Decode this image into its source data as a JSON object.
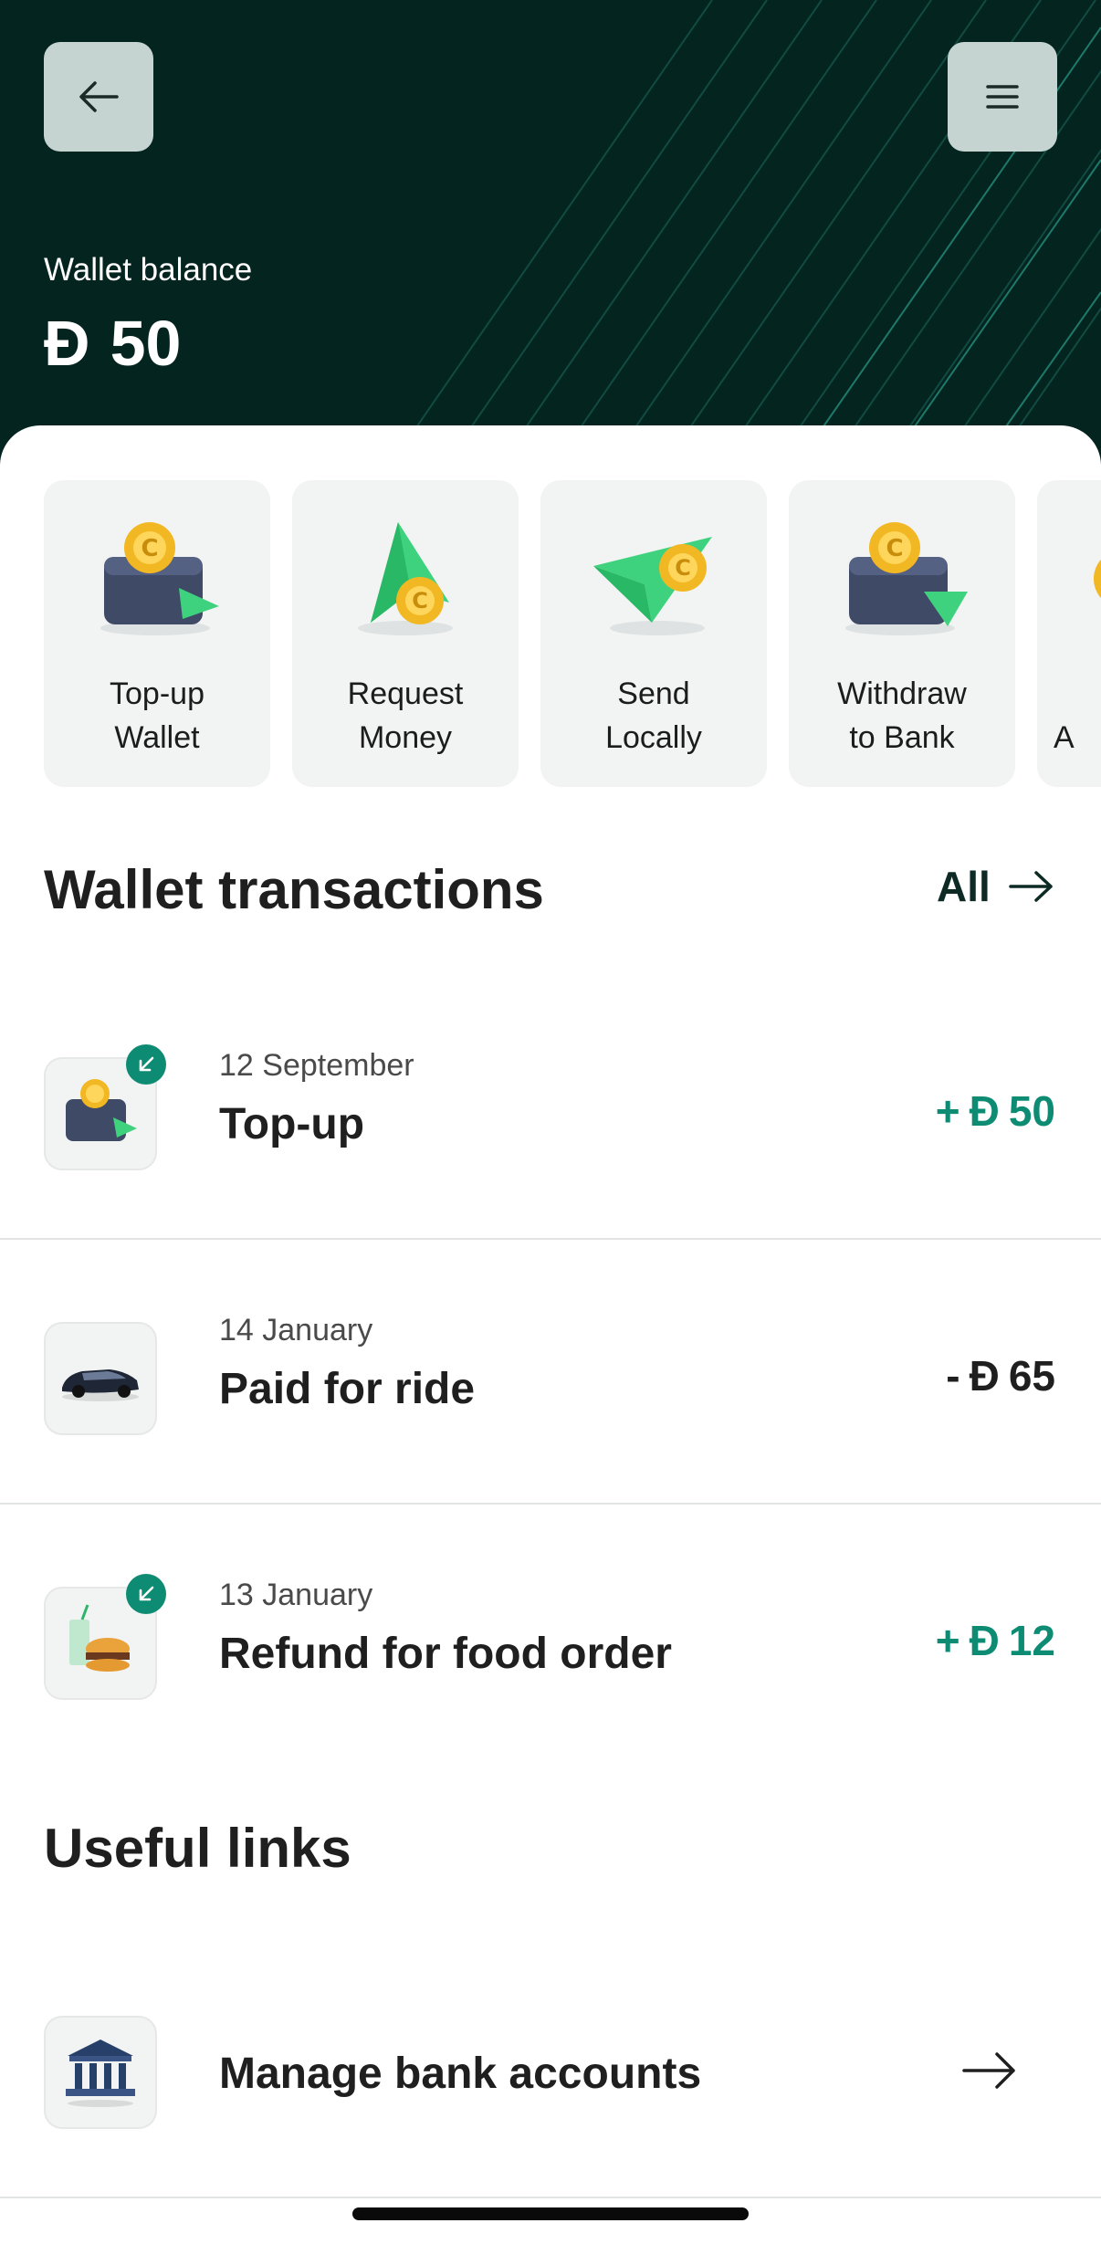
{
  "colors": {
    "header_bg": "#03241f",
    "positive_amount": "#0e8c73",
    "negative_amount": "#1f1f1f",
    "tile_bg": "#f2f3f3"
  },
  "header": {
    "back_icon": "arrow-left-icon",
    "menu_icon": "hamburger-menu-icon",
    "balance_label": "Wallet balance",
    "currency_symbol": "Đ",
    "balance_value": "50"
  },
  "actions": [
    {
      "label": "Top-up\nWallet",
      "icon": "wallet-coin-arrow-icon"
    },
    {
      "label": "Request\nMoney",
      "icon": "star-arrow-coin-icon"
    },
    {
      "label": "Send\nLocally",
      "icon": "paper-plane-coin-icon"
    },
    {
      "label": "Withdraw\nto Bank",
      "icon": "wallet-coin-down-icon"
    },
    {
      "label": "A",
      "icon": "coin-icon"
    }
  ],
  "transactions_section": {
    "title": "Wallet transactions",
    "all_label": "All"
  },
  "transactions": [
    {
      "date": "12 September",
      "title": "Top-up",
      "sign": "+",
      "currency": "Đ",
      "value": "50",
      "direction": "incoming",
      "icon": "wallet-topup-icon"
    },
    {
      "date": "14 January",
      "title": "Paid for ride",
      "sign": "-",
      "currency": "Đ",
      "value": "65",
      "direction": "outgoing",
      "icon": "car-icon"
    },
    {
      "date": "13 January",
      "title": "Refund for food order",
      "sign": "+",
      "currency": "Đ",
      "value": "12",
      "direction": "incoming",
      "icon": "burger-drink-icon"
    }
  ],
  "links_section": {
    "title": "Useful links"
  },
  "links": [
    {
      "label": "Manage bank accounts",
      "icon": "bank-icon"
    }
  ]
}
